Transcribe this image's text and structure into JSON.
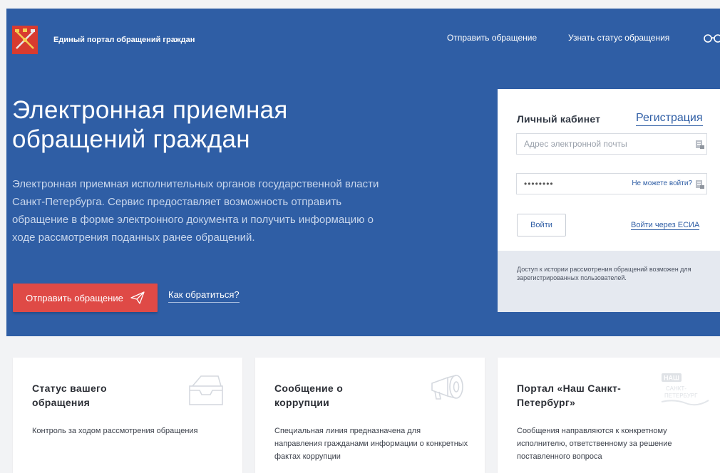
{
  "header": {
    "site_title": "Единый портал обращений граждан",
    "nav": [
      {
        "label": "Отправить обращение"
      },
      {
        "label": "Узнать статус обращения"
      }
    ],
    "accessibility_icon": "glasses-icon"
  },
  "hero": {
    "title_line1": "Электронная приемная",
    "title_line2": "обращений граждан",
    "description": "Электронная приемная исполнительных органов государственной власти Санкт-Петербурга. Сервис предоставляет возможность отправить обращение в форме электронного документа и получить информацию о ходе рассмотрения поданных ранее обращений.",
    "cta_label": "Отправить обращение",
    "how_label": "Как обратиться?"
  },
  "login": {
    "title": "Личный кабинет",
    "register_label": "Регистрация",
    "email_placeholder": "Адрес электронной почты",
    "email_value": "",
    "password_value": "••••••••",
    "cant_login_label": "Не можете войти?",
    "submit_label": "Войти",
    "esia_label": "Войти через ЕСИА",
    "note": "Доступ к истории рассмотрения обращений возможен для зарегистрированных пользователей."
  },
  "cards": [
    {
      "title": "Статус вашего обращения",
      "text": "Контроль за ходом рассмотрения обращения",
      "icon": "inbox-tray-icon"
    },
    {
      "title": "Сообщение о коррупции",
      "text": "Специальная линия предназначена для направления гражданами информации о конкретных фактах коррупции",
      "icon": "megaphone-icon"
    },
    {
      "title": "Портал «Наш Санкт-Петербург»",
      "text": "Сообщения направляются к конкретному исполнителю, ответственному за решение поставленного вопроса",
      "icon": "nash-spb-logo-icon",
      "logo_text": [
        "НАШ",
        "САНКТ-",
        "ПЕТЕРБУРГ"
      ]
    }
  ],
  "colors": {
    "hero_bg": "#2f5ea5",
    "accent_red": "#df4a46",
    "link_blue": "#2f5ea5",
    "page_bg": "#f2f3f5"
  }
}
